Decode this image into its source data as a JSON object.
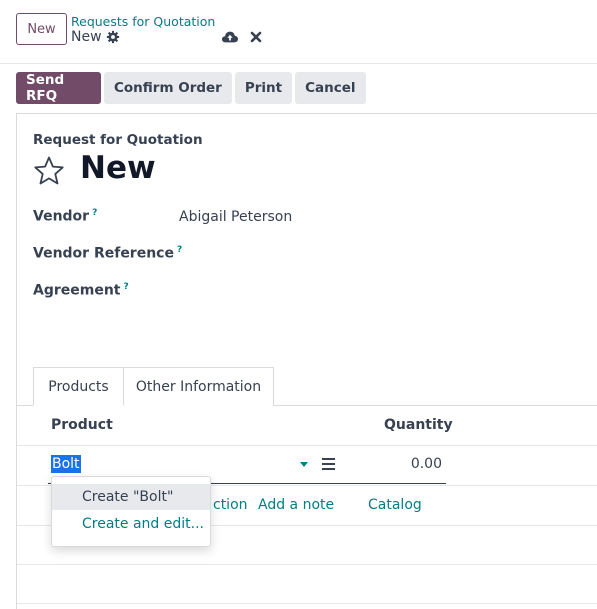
{
  "topbar": {
    "new_label": "New",
    "breadcrumb": "Requests for Quotation",
    "record_name": "New"
  },
  "actions": {
    "send": "Send RFQ",
    "confirm": "Confirm Order",
    "print": "Print",
    "cancel": "Cancel"
  },
  "form": {
    "doc_type": "Request for Quotation",
    "title": "New",
    "fields": {
      "vendor_label": "Vendor",
      "vendor_value": "Abigail Peterson",
      "vendor_ref_label": "Vendor Reference",
      "agreement_label": "Agreement",
      "help_mark": "?"
    }
  },
  "tabs": {
    "products": "Products",
    "other": "Other Information"
  },
  "table": {
    "col_product": "Product",
    "col_quantity": "Quantity",
    "row": {
      "product": "Bolt",
      "quantity": "0.00"
    },
    "add_section": "ction",
    "add_note": "Add a note",
    "catalog": "Catalog"
  },
  "dropdown": {
    "create": "Create \"Bolt\"",
    "create_edit": "Create and edit..."
  },
  "colors": {
    "brand": "#714b67",
    "link": "#017e84",
    "selection": "#1a73e8"
  },
  "icons": [
    "gear-icon",
    "cloud-upload-icon",
    "close-icon",
    "star-icon",
    "drag-handle-icon",
    "caret-down-icon"
  ]
}
